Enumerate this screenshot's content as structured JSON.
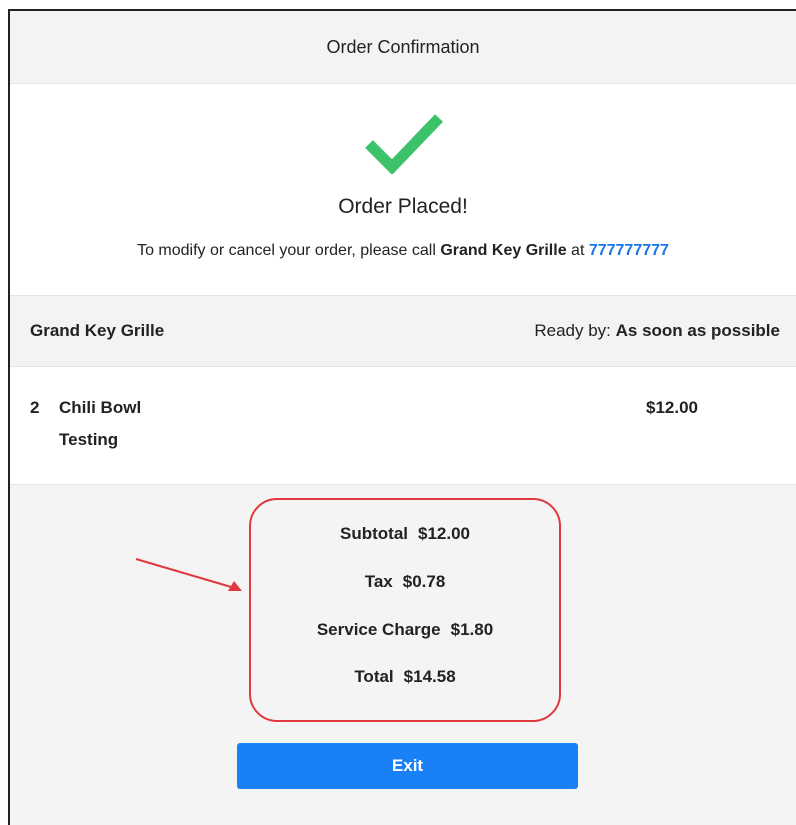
{
  "header": {
    "title": "Order Confirmation"
  },
  "confirmation": {
    "icon": "checkmark-icon",
    "title": "Order Placed!",
    "message_prefix": "To modify or cancel your order, please call ",
    "restaurant": "Grand Key Grille",
    "message_mid": " at ",
    "phone": "777777777"
  },
  "store": {
    "name": "Grand Key Grille",
    "ready_label": "Ready by: ",
    "ready_value": "As soon as possible"
  },
  "items": [
    {
      "qty": "2",
      "name": "Chili Bowl",
      "note": "Testing",
      "price": "$12.00"
    }
  ],
  "totals": {
    "subtotal_label": "Subtotal",
    "subtotal_value": "$12.00",
    "tax_label": "Tax",
    "tax_value": "$0.78",
    "service_label": "Service Charge",
    "service_value": "$1.80",
    "total_label": "Total",
    "total_value": "$14.58"
  },
  "colors": {
    "accent": "#1a80f5",
    "link": "#1a75e8",
    "check": "#3cc36a",
    "annotation": "#e0383e"
  },
  "actions": {
    "exit_label": "Exit"
  }
}
